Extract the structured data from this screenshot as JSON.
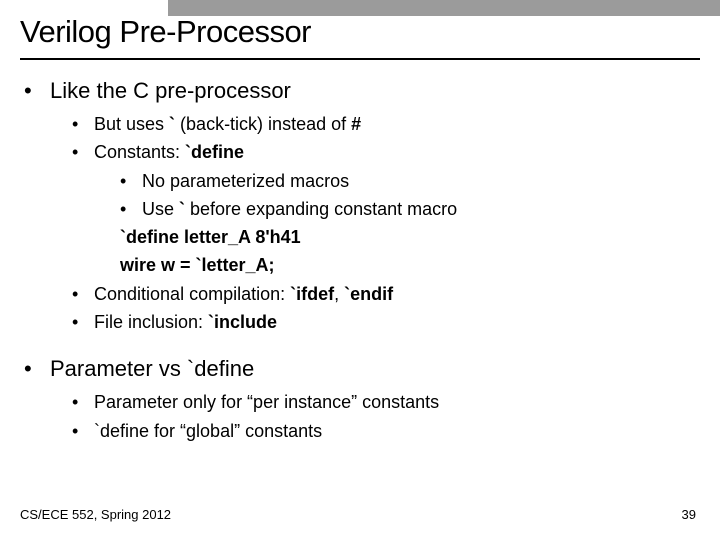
{
  "title": "Verilog Pre-Processor",
  "point1": "Like the C pre-processor",
  "p1_sub1_a": "But uses ",
  "p1_sub1_b": "`",
  "p1_sub1_c": " (back-tick) instead of ",
  "p1_sub1_d": "#",
  "p1_sub2_a": "Constants: ",
  "p1_sub2_b": "`define",
  "p1_sub2_sub1": "No parameterized macros",
  "p1_sub2_sub2_a": "Use ",
  "p1_sub2_sub2_b": "`",
  "p1_sub2_sub2_c": " before expanding constant macro",
  "example1": "`define letter_A 8'h41",
  "example2": "wire w = `letter_A;",
  "p1_sub3_a": "Conditional compilation: ",
  "p1_sub3_b": "`ifdef",
  "p1_sub3_c": ", ",
  "p1_sub3_d": "`endif",
  "p1_sub4_a": "File inclusion: ",
  "p1_sub4_b": "`include",
  "point2": "Parameter vs `define",
  "p2_sub1": "Parameter only for “per instance” constants",
  "p2_sub2": "`define for “global” constants",
  "footer_left": "CS/ECE 552, Spring 2012",
  "footer_right": "39"
}
